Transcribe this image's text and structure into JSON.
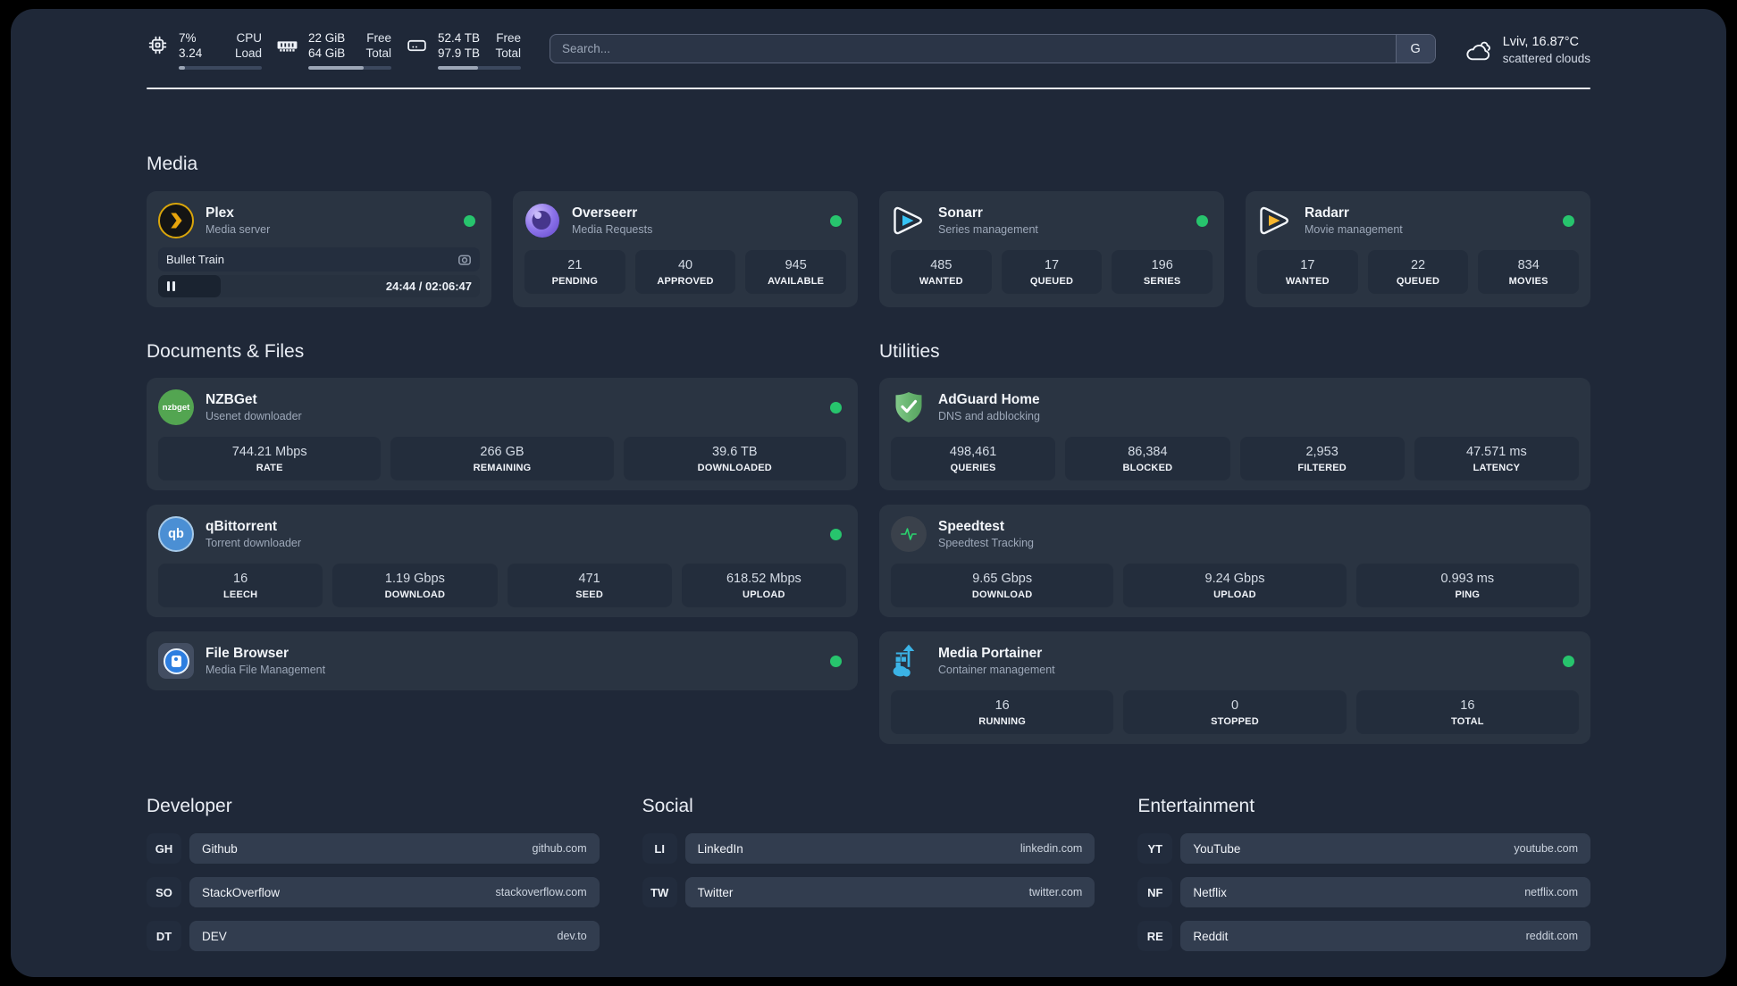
{
  "colors": {
    "status_online": "#27c46d",
    "plex_accent": "#e5a00d",
    "panel_bg": "#1f2838",
    "card_bg": "#2a3442"
  },
  "header": {
    "cpu": {
      "value1": "7%",
      "value2": "3.24",
      "label1": "CPU",
      "label2": "Load",
      "progress": 8
    },
    "memory": {
      "value1": "22 GiB",
      "value2": "64 GiB",
      "label1": "Free",
      "label2": "Total",
      "progress": 67
    },
    "disk": {
      "value1": "52.4 TB",
      "value2": "97.9 TB",
      "label1": "Free",
      "label2": "Total",
      "progress": 48
    },
    "search": {
      "placeholder": "Search...",
      "button_label": "G"
    },
    "weather": {
      "location": "Lviv, 16.87°C",
      "condition": "scattered clouds"
    }
  },
  "media": {
    "heading": "Media",
    "plex": {
      "name": "Plex",
      "desc": "Media server",
      "now_playing": "Bullet Train",
      "time": "24:44 / 02:06:47",
      "progress": 19.5
    },
    "overseerr": {
      "name": "Overseerr",
      "desc": "Media Requests",
      "stats": [
        {
          "value": "21",
          "label": "PENDING"
        },
        {
          "value": "40",
          "label": "APPROVED"
        },
        {
          "value": "945",
          "label": "AVAILABLE"
        }
      ]
    },
    "sonarr": {
      "name": "Sonarr",
      "desc": "Series management",
      "stats": [
        {
          "value": "485",
          "label": "WANTED"
        },
        {
          "value": "17",
          "label": "QUEUED"
        },
        {
          "value": "196",
          "label": "SERIES"
        }
      ]
    },
    "radarr": {
      "name": "Radarr",
      "desc": "Movie management",
      "stats": [
        {
          "value": "17",
          "label": "WANTED"
        },
        {
          "value": "22",
          "label": "QUEUED"
        },
        {
          "value": "834",
          "label": "MOVIES"
        }
      ]
    }
  },
  "documents": {
    "heading": "Documents & Files",
    "nzbget": {
      "name": "NZBGet",
      "desc": "Usenet downloader",
      "logo": "nzbget",
      "stats": [
        {
          "value": "744.21 Mbps",
          "label": "RATE"
        },
        {
          "value": "266 GB",
          "label": "REMAINING"
        },
        {
          "value": "39.6 TB",
          "label": "DOWNLOADED"
        }
      ]
    },
    "qbittorrent": {
      "name": "qBittorrent",
      "desc": "Torrent downloader",
      "logo": "qb",
      "stats": [
        {
          "value": "16",
          "label": "LEECH"
        },
        {
          "value": "1.19 Gbps",
          "label": "DOWNLOAD"
        },
        {
          "value": "471",
          "label": "SEED"
        },
        {
          "value": "618.52 Mbps",
          "label": "UPLOAD"
        }
      ]
    },
    "filebrowser": {
      "name": "File Browser",
      "desc": "Media File Management"
    }
  },
  "utilities": {
    "heading": "Utilities",
    "adguard": {
      "name": "AdGuard Home",
      "desc": "DNS and adblocking",
      "stats": [
        {
          "value": "498,461",
          "label": "QUERIES"
        },
        {
          "value": "86,384",
          "label": "BLOCKED"
        },
        {
          "value": "2,953",
          "label": "FILTERED"
        },
        {
          "value": "47.571 ms",
          "label": "LATENCY"
        }
      ]
    },
    "speedtest": {
      "name": "Speedtest",
      "desc": "Speedtest Tracking",
      "stats": [
        {
          "value": "9.65 Gbps",
          "label": "DOWNLOAD"
        },
        {
          "value": "9.24 Gbps",
          "label": "UPLOAD"
        },
        {
          "value": "0.993 ms",
          "label": "PING"
        }
      ]
    },
    "portainer": {
      "name": "Media Portainer",
      "desc": "Container management",
      "stats": [
        {
          "value": "16",
          "label": "RUNNING"
        },
        {
          "value": "0",
          "label": "STOPPED"
        },
        {
          "value": "16",
          "label": "TOTAL"
        }
      ]
    }
  },
  "links": {
    "developer": {
      "heading": "Developer",
      "items": [
        {
          "tag": "GH",
          "name": "Github",
          "url": "github.com"
        },
        {
          "tag": "SO",
          "name": "StackOverflow",
          "url": "stackoverflow.com"
        },
        {
          "tag": "DT",
          "name": "DEV",
          "url": "dev.to"
        }
      ]
    },
    "social": {
      "heading": "Social",
      "items": [
        {
          "tag": "LI",
          "name": "LinkedIn",
          "url": "linkedin.com"
        },
        {
          "tag": "TW",
          "name": "Twitter",
          "url": "twitter.com"
        }
      ]
    },
    "entertainment": {
      "heading": "Entertainment",
      "items": [
        {
          "tag": "YT",
          "name": "YouTube",
          "url": "youtube.com"
        },
        {
          "tag": "NF",
          "name": "Netflix",
          "url": "netflix.com"
        },
        {
          "tag": "RE",
          "name": "Reddit",
          "url": "reddit.com"
        }
      ]
    }
  }
}
